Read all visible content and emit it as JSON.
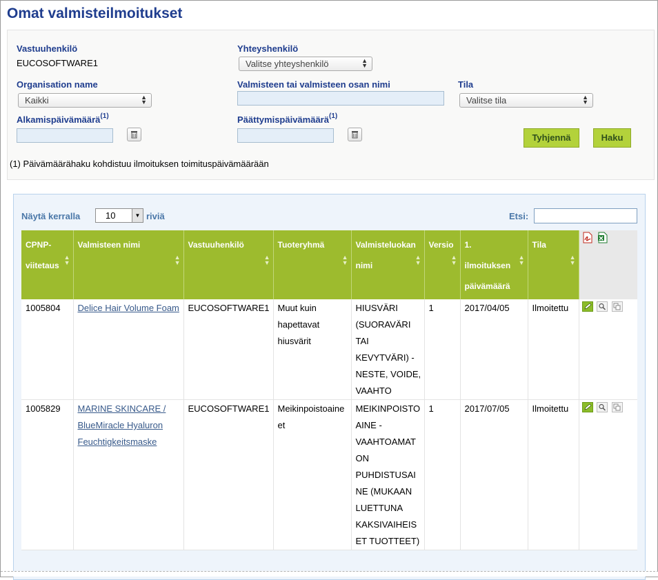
{
  "page": {
    "title": "Omat valmisteilmoitukset"
  },
  "filters": {
    "responsible_label": "Vastuuhenkilö",
    "responsible_value": "EUCOSOFTWARE1",
    "contact_label": "Yhteyshenkilö",
    "contact_select": "Valitse yhteyshenkilö",
    "org_label": "Organisation name",
    "org_select": "Kaikki",
    "product_name_label": "Valmisteen tai valmisteen osan nimi",
    "status_label": "Tila",
    "status_select": "Valitse tila",
    "start_date_label": "Alkamispäivämäärä",
    "end_date_label": "Päättymispäivämäärä",
    "footnote_marker": "(1)",
    "clear_button": "Tyhjennä",
    "search_button": "Haku",
    "footnote": "(1) Päivämäärähaku kohdistuu ilmoituksen toimituspäivämäärään"
  },
  "list": {
    "show_label": "Näytä kerralla",
    "rows_value": "10",
    "rows_suffix": "riviä",
    "search_label": "Etsi:",
    "columns": [
      "CPNP-viitetaus",
      "Valmisteen nimi",
      "Vastuuhenkilö",
      "Tuoteryhmä",
      "Valmisteluokan nimi",
      "Versio",
      "1. ilmoituksen päivämäärä",
      "Tila"
    ],
    "rows": [
      {
        "ref": "1005804",
        "name": "Delice Hair Volume Foam",
        "responsible": "EUCOSOFTWARE1",
        "group": "Muut kuin hapettavat hiusvärit",
        "category": "HIUSVÄRI (SUORAVÄRI TAI KEVYTVÄRI) - NESTE, VOIDE, VAAHTO",
        "version": "1",
        "date": "2017/04/05",
        "status": "Ilmoitettu"
      },
      {
        "ref": "1005829",
        "name": "MARINE SKINCARE / BlueMiracle Hyaluron Feuchtigkeitsmaske",
        "responsible": "EUCOSOFTWARE1",
        "group": "Meikinpoistoaineet",
        "category": "MEIKINPOISTOAINE - VAAHTOAMATON PUHDISTUSAINE (MUKAAN LUETTUNA KAKSIVAIHEISET TUOTTEET)",
        "version": "1",
        "date": "2017/07/05",
        "status": "Ilmoitettu"
      }
    ]
  },
  "icons": {
    "pdf_export": "pdf-export-icon",
    "excel_export": "excel-export-icon",
    "edit": "edit-icon",
    "view": "magnifier-icon",
    "copy": "copy-icon",
    "trash": "trash-icon"
  },
  "colors": {
    "title": "#1f3d8e",
    "header_green": "#9dbb2e",
    "button_green": "#b3d23b",
    "panel_blue": "#eef4fb",
    "link": "#37598a"
  }
}
